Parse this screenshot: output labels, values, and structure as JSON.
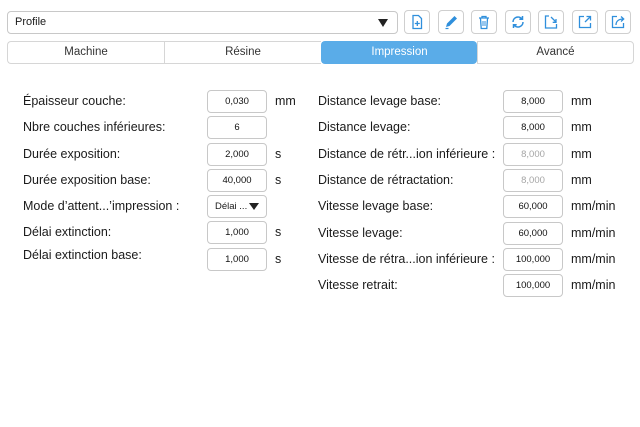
{
  "toolbar": {
    "profile_value": "Profile",
    "icons": [
      "add-file-icon",
      "edit-icon",
      "trash-icon",
      "refresh-icon",
      "import-icon",
      "export-icon",
      "share-icon"
    ],
    "accent_color": "#2f8fdc"
  },
  "tabs": [
    {
      "label": "Machine",
      "active": false
    },
    {
      "label": "Résine",
      "active": false
    },
    {
      "label": "Impression",
      "active": true
    },
    {
      "label": "Avancé",
      "active": false
    }
  ],
  "left": {
    "layer_thickness": {
      "label": "Épaisseur couche:",
      "value": "0,030",
      "unit": "mm"
    },
    "bottom_layers": {
      "label": "Nbre couches inférieures:",
      "value": "6"
    },
    "exposure_time": {
      "label": "Durée exposition:",
      "value": "2,000",
      "unit": "s"
    },
    "bottom_exposure": {
      "label": "Durée exposition base:",
      "value": "40,000",
      "unit": "s"
    },
    "wait_mode": {
      "label": "Mode d’attent...’impression :",
      "value": "Délai ..."
    },
    "light_off_delay": {
      "label": "Délai extinction:",
      "value": "1,000",
      "unit": "s"
    },
    "bottom_light_off_delay": {
      "label": "Délai extinction base:",
      "value": "1,000",
      "unit": "s"
    }
  },
  "right": {
    "bottom_lift_distance": {
      "label": "Distance levage base:",
      "value": "8,000",
      "unit": "mm"
    },
    "lift_distance": {
      "label": "Distance levage:",
      "value": "8,000",
      "unit": "mm"
    },
    "bottom_retract_distance": {
      "label": "Distance de rétr...ion inférieure :",
      "value": "8,000",
      "unit": "mm"
    },
    "retract_distance": {
      "label": "Distance de rétractation:",
      "value": "8,000",
      "unit": "mm"
    },
    "bottom_lift_speed": {
      "label": "Vitesse levage base:",
      "value": "60,000",
      "unit": "mm/min"
    },
    "lift_speed": {
      "label": "Vitesse levage:",
      "value": "60,000",
      "unit": "mm/min"
    },
    "bottom_retract_speed": {
      "label": "Vitesse de rétra...ion inférieure :",
      "value": "100,000",
      "unit": "mm/min"
    },
    "retract_speed": {
      "label": "Vitesse retrait:",
      "value": "100,000",
      "unit": "mm/min"
    }
  }
}
